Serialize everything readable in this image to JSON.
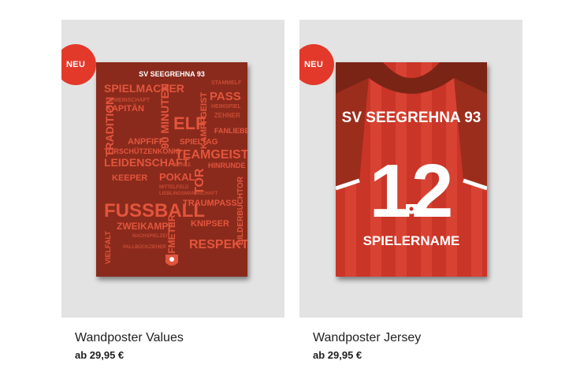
{
  "products": [
    {
      "badge": "NEU",
      "title": "Wandposter Values",
      "price": "ab 29,95 €",
      "poster": {
        "club": "SV SEEGREHNA 93",
        "words": [
          "SPIELMACHER",
          "GEMEINSCHAFT",
          "KAPITÄN",
          "TRADITION",
          "90 MINUTEN",
          "ELF",
          "PASS",
          "STAMMELF",
          "HEIMSPIEL",
          "ZEHNER",
          "KAMPFGEIST",
          "FANLIEBE",
          "SPIELTAG",
          "ANPFIFF",
          "TORSCHÜTZENKÖNIG",
          "LEIDENSCHAFT",
          "TEAMGEIST",
          "HINRUNDE",
          "KEEPER",
          "POKAL",
          "TOR",
          "FLANKE",
          "MITTELFELD",
          "LIEBLINGSMANNSCHAFT",
          "FUSSBALL",
          "TRAUMPASS",
          "BILDERBUCHTOR",
          "ZWEIKAMPF",
          "ELFMETER",
          "KNIPSER",
          "NACHSPIELZEIT",
          "VIELFALT",
          "PALLBÜCKZIEHER",
          "RESPEKT"
        ]
      }
    },
    {
      "badge": "NEU",
      "title": "Wandposter Jersey",
      "price": "ab 29,95 €",
      "poster": {
        "club": "SV SEEGREHNA 93",
        "number": "12",
        "player_name": "SPIELERNAME"
      }
    }
  ]
}
